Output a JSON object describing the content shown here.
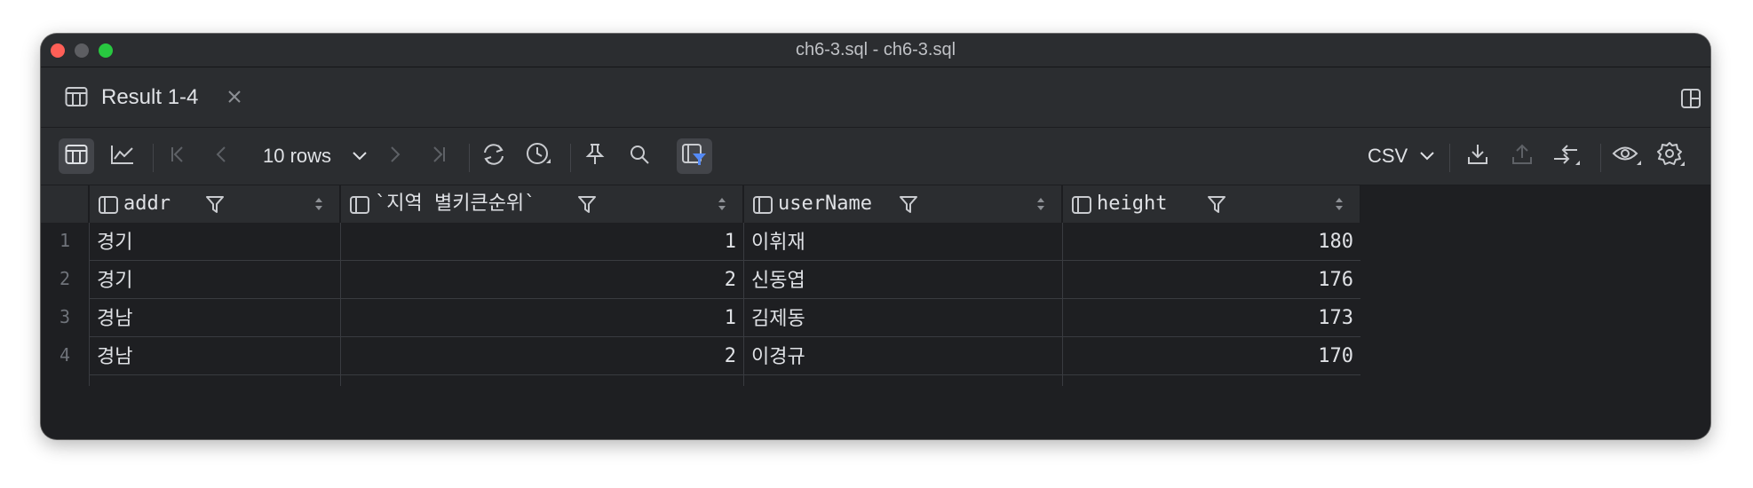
{
  "window": {
    "title": "ch6-3.sql - ch6-3.sql"
  },
  "tab": {
    "label": "Result 1-4",
    "icon": "table-icon",
    "close_icon": "close-icon"
  },
  "toolbar": {
    "rows_label": "10 rows",
    "export_format": "CSV",
    "icons": [
      "table-view-icon",
      "chart-view-icon",
      "first-page-icon",
      "prev-page-icon",
      "next-page-icon",
      "last-page-icon",
      "refresh-icon",
      "history-icon",
      "pin-icon",
      "search-icon",
      "filter-icon",
      "download-icon",
      "upload-icon",
      "compare-icon",
      "eye-icon",
      "gear-icon"
    ]
  },
  "columns": [
    {
      "name": "addr"
    },
    {
      "name": "`지역 별키큰순위`"
    },
    {
      "name": "userName"
    },
    {
      "name": "height"
    }
  ],
  "rows": [
    {
      "num": "1",
      "addr": "경기",
      "rank": "1",
      "userName": "이휘재",
      "height": "180"
    },
    {
      "num": "2",
      "addr": "경기",
      "rank": "2",
      "userName": "신동엽",
      "height": "176"
    },
    {
      "num": "3",
      "addr": "경남",
      "rank": "1",
      "userName": "김제동",
      "height": "173"
    },
    {
      "num": "4",
      "addr": "경남",
      "rank": "2",
      "userName": "이경규",
      "height": "170"
    }
  ],
  "colors": {
    "background": "#1e1f22",
    "panel": "#2b2d30",
    "accent": "#548af7",
    "text": "#dfe1e5"
  }
}
